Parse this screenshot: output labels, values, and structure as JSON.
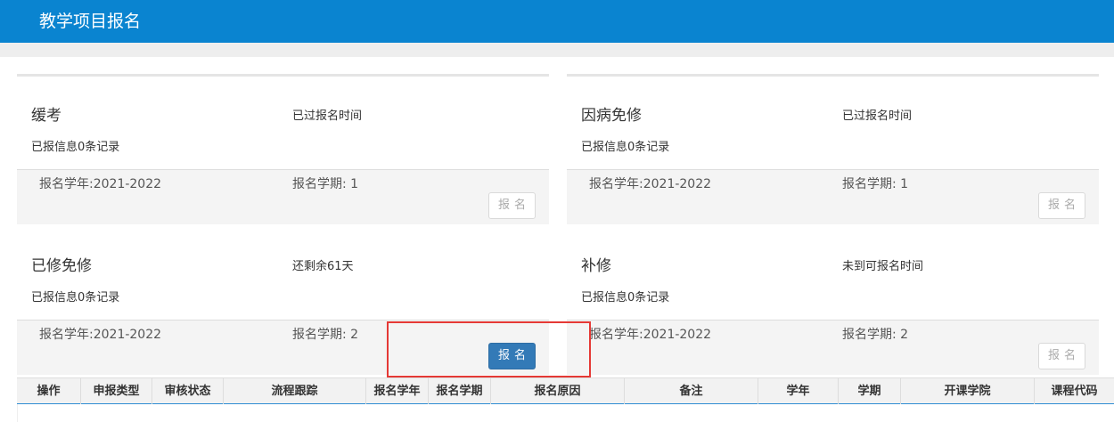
{
  "header": {
    "title": "教学项目报名"
  },
  "cards": [
    {
      "name": "缓考",
      "status": "已过报名时间",
      "info": "已报信息0条记录",
      "year": "报名学年:2021-2022",
      "term": "报名学期: 1",
      "button": "报名",
      "button_state": "disabled"
    },
    {
      "name": "因病免修",
      "status": "已过报名时间",
      "info": "已报信息0条记录",
      "year": "报名学年:2021-2022",
      "term": "报名学期: 1",
      "button": "报名",
      "button_state": "disabled"
    },
    {
      "name": "已修免修",
      "status": "还剩余61天",
      "info": "已报信息0条记录",
      "year": "报名学年:2021-2022",
      "term": "报名学期: 2",
      "button": "报名",
      "button_state": "active"
    },
    {
      "name": "补修",
      "status": "未到可报名时间",
      "info": "已报信息0条记录",
      "year": "报名学年:2021-2022",
      "term": "报名学期: 2",
      "button": "报名",
      "button_state": "disabled"
    }
  ],
  "table": {
    "columns": [
      "操作",
      "申报类型",
      "审核状态",
      "流程跟踪",
      "报名学年",
      "报名学期",
      "报名原因",
      "备注",
      "学年",
      "学期",
      "开课学院",
      "课程代码"
    ]
  },
  "colors": {
    "header_bg": "#0a84d0",
    "primary_button": "#337ab7",
    "highlight_border": "#e53935",
    "table_header_line": "#2f8ed3"
  }
}
